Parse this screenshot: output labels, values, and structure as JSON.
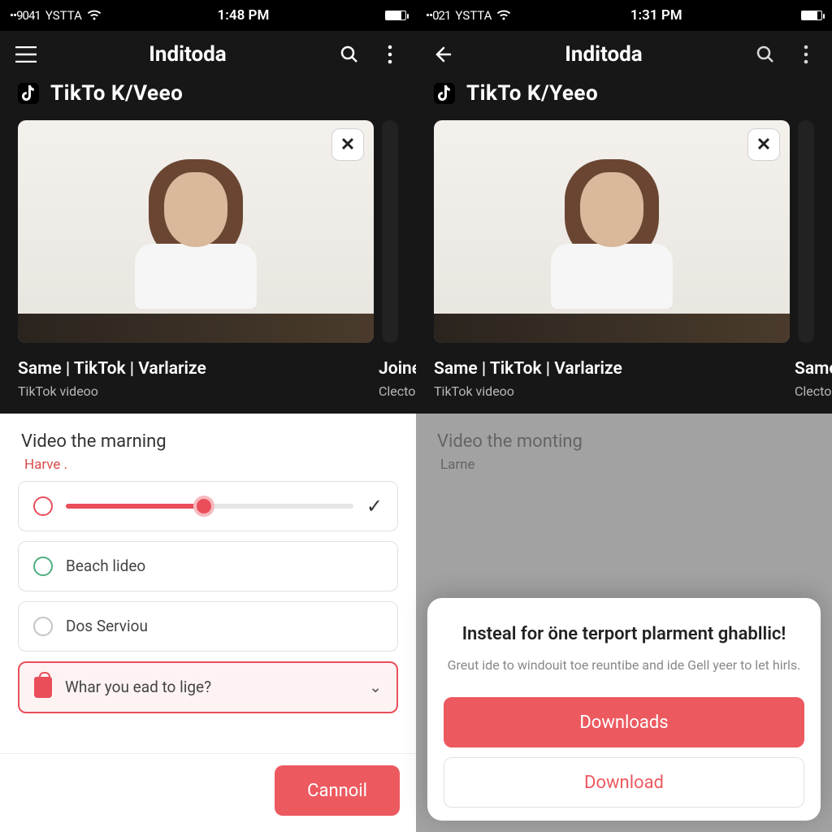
{
  "left": {
    "status": {
      "signal": "••9041",
      "carrier": "YSTTA",
      "time": "1:48 PM"
    },
    "appbar": {
      "title": "Inditoda",
      "menu_icon": "menu-icon",
      "search_icon": "search-icon",
      "more_icon": "more-icon"
    },
    "subheader": "TikTo K/Veeo",
    "card": {
      "title": "Same | TikTok | Varlarize",
      "subtitle": "TikTok videoo",
      "close_glyph": "✕"
    },
    "nextcard": {
      "title": "Joine",
      "subtitle": "Clecto"
    },
    "section_heading": "Video the marning",
    "subtle_link": "Harve .",
    "slider": {
      "check_glyph": "✓"
    },
    "options": [
      {
        "label": "Beach lideo"
      },
      {
        "label": "Dos Serviou"
      }
    ],
    "select": {
      "label": "Whar you ead to lige?",
      "chevron": "⌄"
    },
    "footer": {
      "cancel": "Cannoil"
    }
  },
  "right": {
    "status": {
      "signal": "••021",
      "carrier": "YSTTA",
      "time": "1:31 PM"
    },
    "appbar": {
      "title": "Inditoda",
      "back_icon": "back-icon",
      "search_icon": "search-icon",
      "more_icon": "more-icon"
    },
    "subheader": "TikTo K/Yeeo",
    "card": {
      "title": "Same | TikTok | Varlarize",
      "subtitle": "TikTok videoo",
      "close_glyph": "✕"
    },
    "nextcard": {
      "title": "Same",
      "subtitle": "Clecto"
    },
    "section_heading": "Video the monting",
    "subtle_link": "Larne",
    "modal": {
      "title": "Insteal for öne terport plarment ghabllic!",
      "desc": "Greut ide to windouit toe reuntibe and ide Gell yeer to let hirls.",
      "primary": "Downloads",
      "secondary": "Download"
    }
  }
}
